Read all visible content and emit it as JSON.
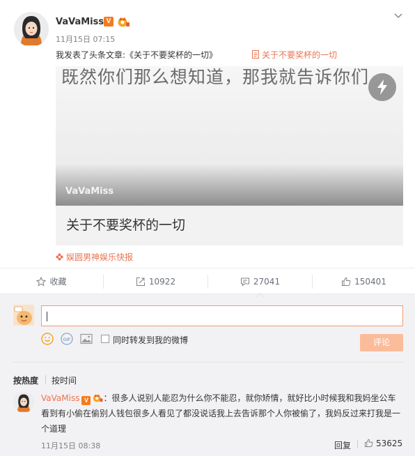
{
  "post": {
    "author": "VaVaMiss",
    "verified_badge": "V",
    "timestamp": "11月15日 07:15",
    "text": "我发表了头条文章:《关于不要奖杯的一切》",
    "article_link": "关于不要奖杯的一切",
    "card": {
      "image_headline": "既然你们那么想知道，那我就告诉你们",
      "watermark": "VaVaMiss",
      "title": "关于不要奖杯的一切"
    },
    "source": "娱圆男神娱乐快报"
  },
  "actions": {
    "favorite_label": "收藏",
    "repost_count": "10922",
    "comment_count": "27041",
    "like_count": "150401"
  },
  "composer": {
    "repost_checkbox_label": "同时转发到我的微博",
    "submit_label": "评论"
  },
  "sort": {
    "hot_label": "按热度",
    "time_label": "按时间"
  },
  "comment": {
    "author": "VaVaMiss",
    "verified_badge": "V",
    "text": "：很多人说别人能忍为什么你不能忍，就你矫情，就好比小时候我和我妈坐公车看到有小偷在偷别人钱包很多人看见了都没说话我上去告诉那个人你被偷了，我妈反过来打我是一个道理",
    "timestamp": "11月15日 08:38",
    "reply_label": "回复",
    "like_count": "53625"
  },
  "colors": {
    "accent": "#eb7350",
    "badge": "#f57b1e",
    "submit_disabled": "#fbbc9b"
  }
}
